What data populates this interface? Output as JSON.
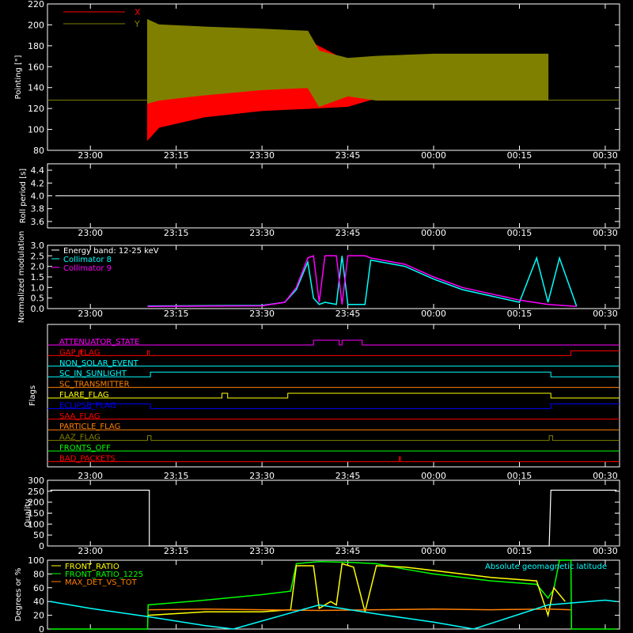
{
  "x_ticks": [
    "23:00",
    "23:15",
    "23:30",
    "23:45",
    "00:00",
    "00:15",
    "00:30"
  ],
  "colors": {
    "x": "#ff0000",
    "y": "#808000",
    "white": "#ffffff",
    "cyan": "#00ffff",
    "magenta": "#ff00ff",
    "green": "#00ff00",
    "yellow": "#ffff00",
    "orange": "#ff8000",
    "blue": "#0000ff",
    "red": "#ff0000"
  },
  "chart_data": [
    {
      "id": "pointing",
      "type": "area",
      "ylabel": "Pointing [\"]",
      "ylim": [
        80,
        220
      ],
      "y_ticks": [
        80,
        100,
        120,
        140,
        160,
        180,
        200,
        220
      ],
      "legend": [
        {
          "name": "X",
          "color": "#ff0000"
        },
        {
          "name": "Y",
          "color": "#808000"
        }
      ],
      "baseline": 128,
      "series": [
        {
          "name": "X",
          "color": "#ff0000",
          "x_minutes": [
            10,
            12,
            20,
            30,
            38,
            45,
            50,
            60,
            70,
            80
          ],
          "lower": [
            90,
            102,
            112,
            118,
            120,
            122,
            130,
            131,
            132,
            133
          ],
          "upper": [
            175,
            170,
            165,
            162,
            185,
            165,
            160,
            158,
            158,
            158
          ]
        },
        {
          "name": "Y",
          "color": "#808000",
          "x_minutes": [
            10,
            12,
            20,
            30,
            38,
            40,
            45,
            50,
            60,
            70,
            80
          ],
          "lower": [
            125,
            128,
            133,
            138,
            140,
            122,
            132,
            128,
            128,
            128,
            128
          ],
          "upper": [
            205,
            200,
            198,
            196,
            194,
            175,
            168,
            170,
            172,
            172,
            172
          ]
        }
      ]
    },
    {
      "id": "roll",
      "type": "line",
      "ylabel": "Roll period [s]",
      "ylim": [
        3.5,
        4.5
      ],
      "y_ticks": [
        "3.6",
        "3.8",
        "4.0",
        "4.2",
        "4.4"
      ],
      "value": 4.0
    },
    {
      "id": "modulation",
      "type": "line",
      "ylabel": "Normalized modulation",
      "ylim": [
        0,
        3
      ],
      "y_ticks": [
        "0.0",
        "0.5",
        "1.0",
        "1.5",
        "2.0",
        "2.5",
        "3.0"
      ],
      "legend": [
        {
          "name": "Energy band: 12-25 keV",
          "color": "#ffffff"
        },
        {
          "name": "Collimator 8",
          "color": "#00ffff"
        },
        {
          "name": "Collimator 9",
          "color": "#ff00ff"
        }
      ],
      "series": [
        {
          "name": "Collimator 8",
          "color": "#00ffff",
          "x_minutes": [
            10,
            30,
            34,
            36,
            38,
            39,
            40,
            41,
            43,
            44,
            45,
            48,
            49,
            55,
            60,
            65,
            70,
            75,
            78,
            80,
            82,
            85
          ],
          "values": [
            0.12,
            0.15,
            0.3,
            0.9,
            2.2,
            0.5,
            0.2,
            0.3,
            0.2,
            2.5,
            0.2,
            0.2,
            2.3,
            2.0,
            1.4,
            0.9,
            0.6,
            0.3,
            2.4,
            0.3,
            2.4,
            0.1
          ]
        },
        {
          "name": "Collimator 9",
          "color": "#ff00ff",
          "x_minutes": [
            10,
            30,
            34,
            36,
            38,
            39,
            40,
            41,
            43,
            44,
            45,
            48,
            49,
            55,
            60,
            65,
            70,
            75,
            80,
            85
          ],
          "values": [
            0.1,
            0.13,
            0.3,
            1.0,
            2.4,
            2.5,
            0.3,
            2.5,
            2.5,
            0.2,
            2.5,
            2.5,
            2.4,
            2.1,
            1.5,
            1.0,
            0.7,
            0.4,
            0.2,
            0.1
          ]
        }
      ]
    },
    {
      "id": "flags",
      "type": "line",
      "ylabel": "Flags",
      "rows": [
        {
          "label": "ATTENUATOR_STATE",
          "color": "#ff00ff",
          "steps": [
            [
              0,
              0
            ],
            [
              39,
              1
            ],
            [
              43.5,
              0
            ],
            [
              44,
              1
            ],
            [
              47.5,
              0
            ]
          ]
        },
        {
          "label": "GAP_FLAG",
          "color": "#ff0000",
          "steps": [
            [
              0,
              0
            ],
            [
              -2,
              1
            ],
            [
              -1.5,
              0
            ],
            [
              10,
              1
            ],
            [
              10.3,
              0
            ],
            [
              84,
              1
            ]
          ]
        },
        {
          "label": "NON_SOLAR_EVENT",
          "color": "#00ffff",
          "steps": [
            [
              0,
              0
            ]
          ]
        },
        {
          "label": "SC_IN_SUNLIGHT",
          "color": "#00ffff",
          "steps": [
            [
              0,
              0
            ],
            [
              10.5,
              1
            ],
            [
              80.5,
              0
            ]
          ]
        },
        {
          "label": "SC_TRANSMITTER",
          "color": "#ff8000",
          "steps": [
            [
              0,
              0
            ]
          ]
        },
        {
          "label": "FLARE_FLAG",
          "color": "#ffff00",
          "steps": [
            [
              0,
              0
            ],
            [
              23,
              1
            ],
            [
              24,
              0
            ],
            [
              34.5,
              1
            ],
            [
              80.5,
              0
            ]
          ]
        },
        {
          "label": "ECLIPSE_FLAG",
          "color": "#0000ff",
          "steps": [
            [
              0,
              1
            ],
            [
              10.5,
              0
            ],
            [
              80.5,
              1
            ]
          ]
        },
        {
          "label": "SAA_FLAG",
          "color": "#ff0000",
          "steps": [
            [
              0,
              0
            ]
          ]
        },
        {
          "label": "PARTICLE_FLAG",
          "color": "#ff8000",
          "steps": [
            [
              0,
              0
            ]
          ]
        },
        {
          "label": "AAZ_FLAG",
          "color": "#808000",
          "steps": [
            [
              0,
              0
            ],
            [
              10,
              1
            ],
            [
              10.6,
              0
            ],
            [
              80.2,
              1
            ],
            [
              80.8,
              0
            ]
          ]
        },
        {
          "label": "FRONTS_OFF",
          "color": "#00ff00",
          "steps": [
            [
              0,
              0
            ]
          ]
        },
        {
          "label": "BAD_PACKETS",
          "color": "#ff0000",
          "steps": [
            [
              0,
              0
            ],
            [
              54,
              1
            ],
            [
              54.2,
              0
            ]
          ]
        }
      ]
    },
    {
      "id": "quality",
      "type": "line",
      "ylabel": "Quality",
      "ylim": [
        0,
        300
      ],
      "y_ticks": [
        0,
        50,
        100,
        150,
        200,
        250,
        300
      ],
      "steps": [
        [
          -7,
          255
        ],
        [
          10.3,
          255
        ],
        [
          10.3,
          0
        ],
        [
          80.2,
          0
        ],
        [
          80.5,
          255
        ],
        [
          92,
          255
        ]
      ]
    },
    {
      "id": "ratios",
      "type": "line",
      "ylabel": "Degrees or %",
      "ylim": [
        0,
        100
      ],
      "y_ticks": [
        0,
        20,
        40,
        60,
        80,
        100
      ],
      "legend": [
        {
          "name": "FRONT_RATIO",
          "color": "#ffff00"
        },
        {
          "name": "FRONT_RATIO_1225",
          "color": "#00ff00"
        },
        {
          "name": "MAX_DET_VS_TOT",
          "color": "#ff8000"
        },
        {
          "name": "Absolute geomagnetic latitude",
          "color": "#00ffff"
        }
      ],
      "series": [
        {
          "name": "FRONT_RATIO_1225",
          "color": "#00ff00",
          "x_minutes": [
            -7,
            10,
            10.1,
            20,
            30,
            35,
            36,
            40,
            45,
            50,
            55,
            60,
            70,
            78,
            80,
            81,
            82,
            84,
            84.1,
            92
          ],
          "values": [
            0,
            0,
            35,
            42,
            50,
            55,
            95,
            98,
            97,
            95,
            87,
            80,
            70,
            65,
            45,
            58,
            100,
            100,
            0,
            0
          ]
        },
        {
          "name": "FRONT_RATIO",
          "color": "#ffff00",
          "x_minutes": [
            10.1,
            20,
            30,
            35,
            36,
            39,
            40,
            42,
            43,
            44,
            46,
            48,
            50,
            55,
            60,
            70,
            78,
            80,
            81,
            83
          ],
          "values": [
            20,
            25,
            25,
            28,
            92,
            92,
            30,
            40,
            35,
            95,
            90,
            25,
            92,
            90,
            85,
            75,
            70,
            20,
            60,
            40
          ]
        },
        {
          "name": "MAX_DET_VS_TOT",
          "color": "#ff8000",
          "x_minutes": [
            10.1,
            20,
            30,
            40,
            50,
            60,
            70,
            80,
            84
          ],
          "values": [
            28,
            29,
            28,
            27,
            28,
            29,
            28,
            29,
            28
          ]
        },
        {
          "name": "Absolute geomagnetic latitude",
          "color": "#00ffff",
          "x_minutes": [
            -7,
            0,
            10,
            20,
            25,
            40,
            50,
            60,
            67,
            80,
            90,
            92
          ],
          "values": [
            40,
            30,
            18,
            5,
            0,
            35,
            22,
            10,
            0,
            35,
            42,
            40
          ]
        }
      ]
    }
  ]
}
